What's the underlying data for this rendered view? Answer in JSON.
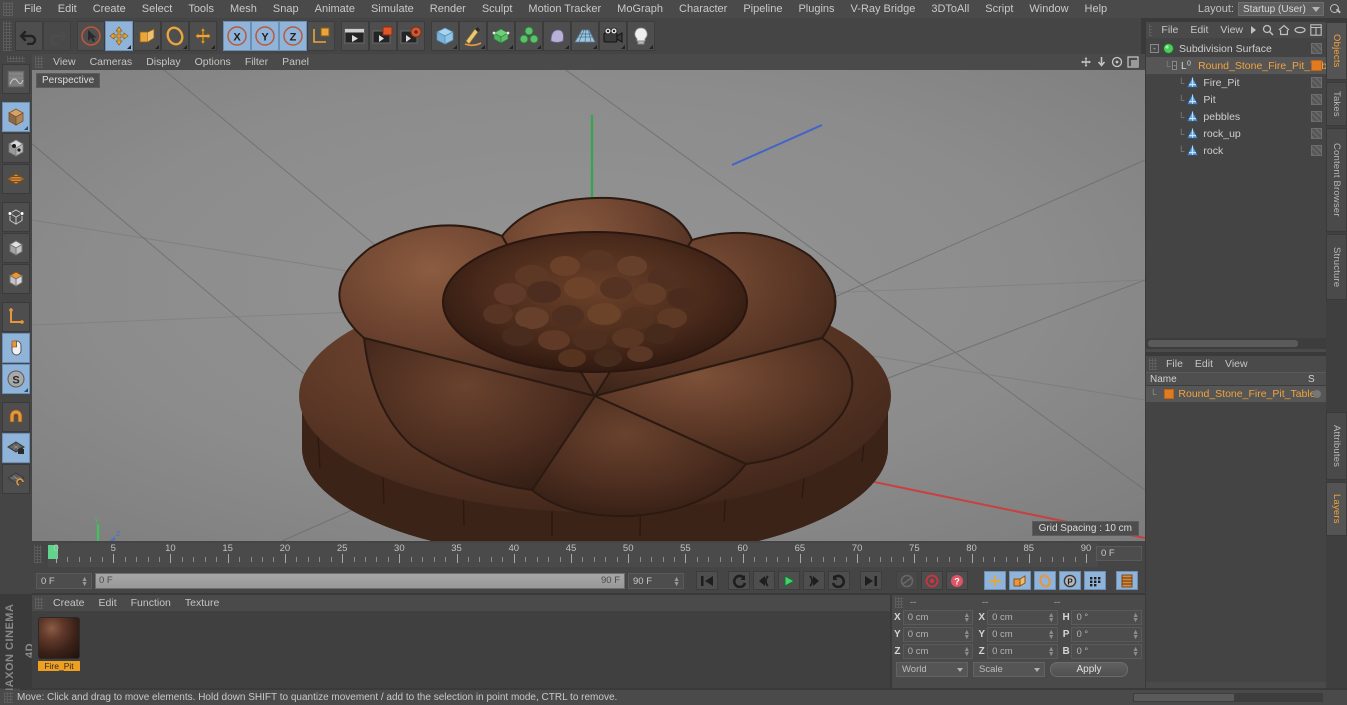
{
  "app": {
    "name": "CINEMA 4D",
    "vendor": "MAXON"
  },
  "menubar": {
    "items": [
      "File",
      "Edit",
      "Create",
      "Select",
      "Tools",
      "Mesh",
      "Snap",
      "Animate",
      "Simulate",
      "Render",
      "Sculpt",
      "Motion Tracker",
      "MoGraph",
      "Character",
      "Pipeline",
      "Plugins",
      "V-Ray Bridge",
      "3DToAll",
      "Script",
      "Window",
      "Help"
    ],
    "layout_label": "Layout:",
    "layout_value": "Startup (User)"
  },
  "toolbar": {
    "undo": "Undo",
    "redo": "Redo",
    "select": "Selection Tool",
    "move": "Move Tool",
    "scale": "Scale Tool",
    "rotate": "Rotate Tool",
    "world": "World/Object Axis",
    "axis_x": "X",
    "axis_y": "Y",
    "axis_z": "Z",
    "render_view": "Render View",
    "render_region": "Render Region",
    "render_settings": "Render Settings",
    "cube": "Cube",
    "spline_pen": "Spline Pen",
    "subdivision_surface": "Subdivision Surface",
    "array": "Array",
    "bend": "Bend Deformer",
    "floor": "Floor",
    "camera": "Camera",
    "light": "Light"
  },
  "left_palette": {
    "items": [
      {
        "name": "texture-mode",
        "selected": false
      },
      {
        "name": "object-mode",
        "selected": true
      },
      {
        "name": "model-mode",
        "selected": false
      },
      {
        "name": "polygon-mode",
        "selected": false
      },
      {
        "name": "point-mode",
        "selected": false
      },
      {
        "name": "edge-mode",
        "selected": false
      },
      {
        "name": "polygon-face-mode",
        "selected": false
      },
      {
        "name": "axis-mode",
        "selected": false
      },
      {
        "name": "viewport-solo",
        "selected": true
      },
      {
        "name": "snap-mode",
        "selected": true
      },
      {
        "name": "magnet-tool",
        "selected": false
      },
      {
        "name": "lock-workplane",
        "selected": true
      },
      {
        "name": "workplane",
        "selected": false
      }
    ]
  },
  "viewport": {
    "menu": [
      "View",
      "Cameras",
      "Display",
      "Options",
      "Filter",
      "Panel"
    ],
    "label": "Perspective",
    "grid_spacing": "Grid Spacing : 10 cm",
    "corner_icons": [
      "pan-icon",
      "zoom-icon",
      "orbit-icon",
      "maximize-icon"
    ],
    "axis_gizmo": {
      "x": "X",
      "y": "Y",
      "z": "Z"
    }
  },
  "timeline": {
    "ticks": [
      0,
      5,
      10,
      15,
      20,
      25,
      30,
      35,
      40,
      45,
      50,
      55,
      60,
      65,
      70,
      75,
      80,
      85,
      90
    ],
    "start_frame": "0 F",
    "end_frame": "90 F",
    "current_frame": "0 F",
    "preview_min": "0 F",
    "preview_max": "90 F",
    "right_field": "0 F"
  },
  "transport": {
    "buttons": [
      {
        "name": "go-to-start",
        "label": "|◀"
      },
      {
        "name": "play-backwards-frame",
        "label": "◀("
      },
      {
        "name": "step-back",
        "label": "◀"
      },
      {
        "name": "play",
        "label": "▶"
      },
      {
        "name": "step-forward",
        "label": ")▶"
      },
      {
        "name": "loop",
        "label": "↻"
      },
      {
        "name": "go-to-end",
        "label": "▶|"
      },
      {
        "name": "record-active-objects",
        "label": "record"
      },
      {
        "name": "autokeying",
        "label": "autokey"
      },
      {
        "name": "keyframe-selection",
        "label": "keysel"
      },
      {
        "name": "position-key",
        "label": "pos"
      },
      {
        "name": "scale-key",
        "label": "scale"
      },
      {
        "name": "rotation-key",
        "label": "rot"
      },
      {
        "name": "parameter-key",
        "label": "P"
      },
      {
        "name": "point-level-animation",
        "label": "pla"
      },
      {
        "name": "timeline-toggle",
        "label": "tl"
      }
    ]
  },
  "material_manager": {
    "menu": [
      "Create",
      "Edit",
      "Function",
      "Texture"
    ],
    "materials": [
      {
        "name": "Fire_Pit",
        "selected": true
      }
    ]
  },
  "coordinates": {
    "headers": [
      "--",
      "--",
      "--"
    ],
    "rows": [
      {
        "axis1": "X",
        "value1": "0 cm",
        "axis2": "X",
        "value2": "0 cm",
        "axis3": "H",
        "value3": "0 °"
      },
      {
        "axis1": "Y",
        "value1": "0 cm",
        "axis2": "Y",
        "value2": "0 cm",
        "axis3": "P",
        "value3": "0 °"
      },
      {
        "axis1": "Z",
        "value1": "0 cm",
        "axis2": "Z",
        "value2": "0 cm",
        "axis3": "B",
        "value3": "0 °"
      }
    ],
    "space_select": "World",
    "mode_select": "Scale",
    "apply_label": "Apply"
  },
  "object_manager": {
    "menu": [
      "File",
      "Edit",
      "View"
    ],
    "objects": [
      {
        "name": "Subdivision Surface",
        "indent": 0,
        "icon": "subdivision-surface-icon",
        "expandable": true,
        "selected": false,
        "highlight": false,
        "tag": "gray"
      },
      {
        "name": "Round_Stone_Fire_Pit_Table",
        "indent": 1,
        "icon": "null-object-icon",
        "expandable": true,
        "selected": true,
        "highlight": true,
        "tag": "orange"
      },
      {
        "name": "Fire_Pit",
        "indent": 2,
        "icon": "polygon-object-icon",
        "expandable": false,
        "selected": false,
        "highlight": false,
        "tag": "gray"
      },
      {
        "name": "Pit",
        "indent": 2,
        "icon": "polygon-object-icon",
        "expandable": false,
        "selected": false,
        "highlight": false,
        "tag": "gray"
      },
      {
        "name": "pebbles",
        "indent": 2,
        "icon": "polygon-object-icon",
        "expandable": false,
        "selected": false,
        "highlight": false,
        "tag": "gray"
      },
      {
        "name": "rock_up",
        "indent": 2,
        "icon": "polygon-object-icon",
        "expandable": false,
        "selected": false,
        "highlight": false,
        "tag": "gray"
      },
      {
        "name": "rock",
        "indent": 2,
        "icon": "polygon-object-icon",
        "expandable": false,
        "selected": false,
        "highlight": false,
        "tag": "gray"
      }
    ]
  },
  "layer_manager": {
    "menu": [
      "File",
      "Edit",
      "View"
    ],
    "columns": [
      "Name",
      "S"
    ],
    "rows": [
      {
        "name": "Round_Stone_Fire_Pit_Table",
        "color": "#e07b1f"
      }
    ]
  },
  "vertical_tabs": [
    {
      "label": "Objects",
      "active": true
    },
    {
      "label": "Takes",
      "active": false
    },
    {
      "label": "Content Browser",
      "active": false
    },
    {
      "label": "Structure",
      "active": false
    },
    {
      "label": "Attributes",
      "active": false
    },
    {
      "label": "Layers",
      "active": true
    }
  ],
  "statusbar": {
    "message": "Move: Click and drag to move elements. Hold down SHIFT to quantize movement / add to the selection in point mode, CTRL to remove."
  },
  "colors": {
    "accent_orange": "#f2a33c",
    "selection_blue": "#8fb3d9",
    "panel_bg": "#4a4a4a",
    "viewport_bg": "#8d8d8d",
    "playhead_green": "#5fd48a"
  }
}
